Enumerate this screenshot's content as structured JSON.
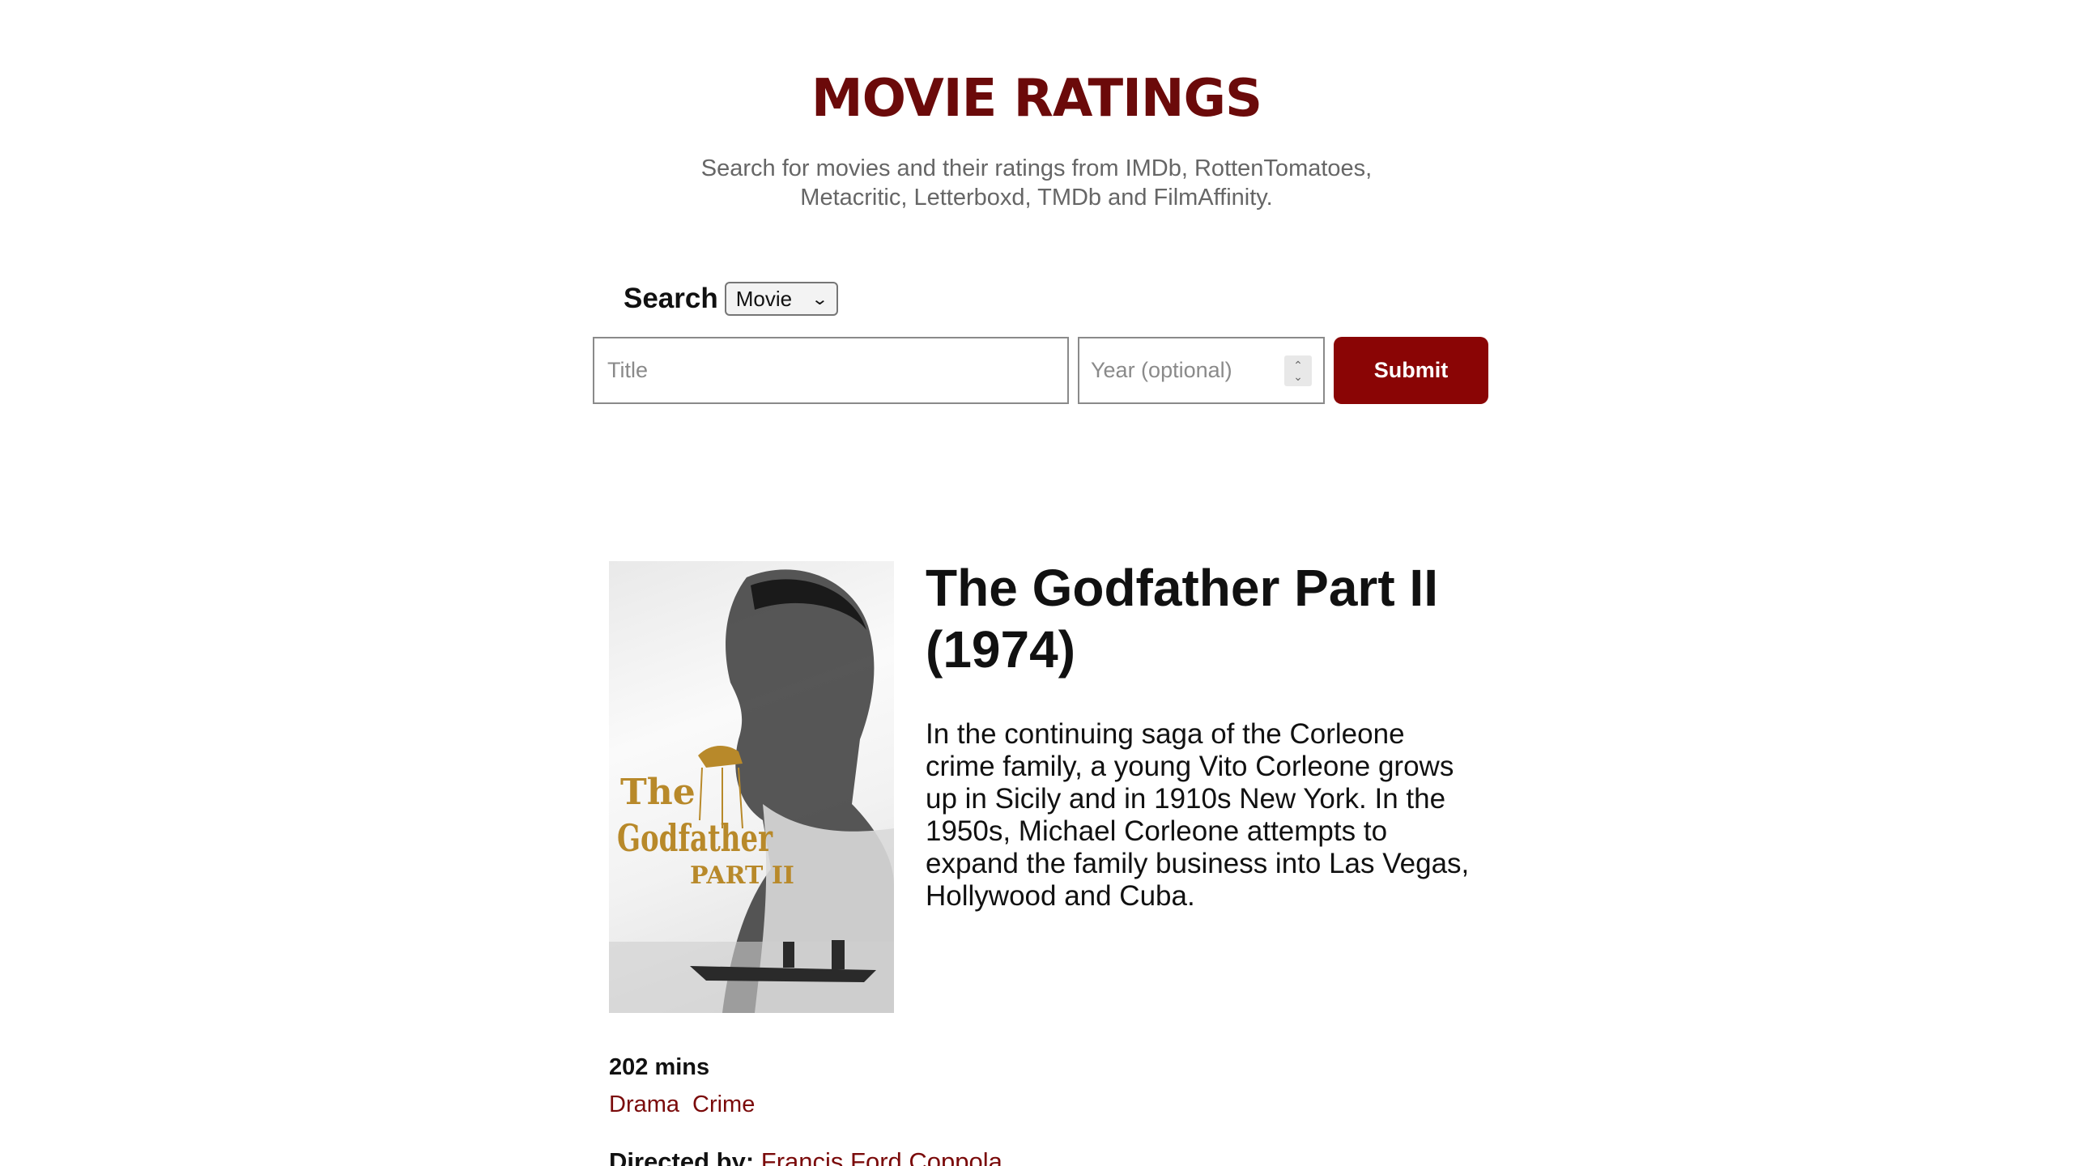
{
  "header": {
    "title": "MOVIE RATINGS",
    "subtitle": "Search for movies and their ratings from IMDb, RottenTomatoes, Metacritic, Letterboxd, TMDb and FilmAffinity."
  },
  "search": {
    "label": "Search",
    "type_selected": "Movie",
    "title_placeholder": "Title",
    "year_placeholder": "Year (optional)",
    "submit_label": "Submit"
  },
  "movie": {
    "title": "The Godfather Part II (1974)",
    "plot": "In the continuing saga of the Corleone crime family, a young Vito Corleone grows up in Sicily and in 1910s New York. In the 1950s, Michael Corleone attempts to expand the family business into Las Vegas, Hollywood and Cuba.",
    "poster_text": [
      "The",
      "Godfather",
      "PART II"
    ],
    "runtime": "202 mins",
    "genres": [
      "Drama",
      "Crime"
    ],
    "director_label": "Directed by:",
    "director": "Francis Ford Coppola"
  },
  "colors": {
    "accent": "#8a0505",
    "title": "#6b0a0a",
    "link": "#7a0a0a",
    "poster_gold": "#b8892a"
  },
  "icons": {
    "select": "chevron-down-icon",
    "spinner": "spinner-icon"
  }
}
